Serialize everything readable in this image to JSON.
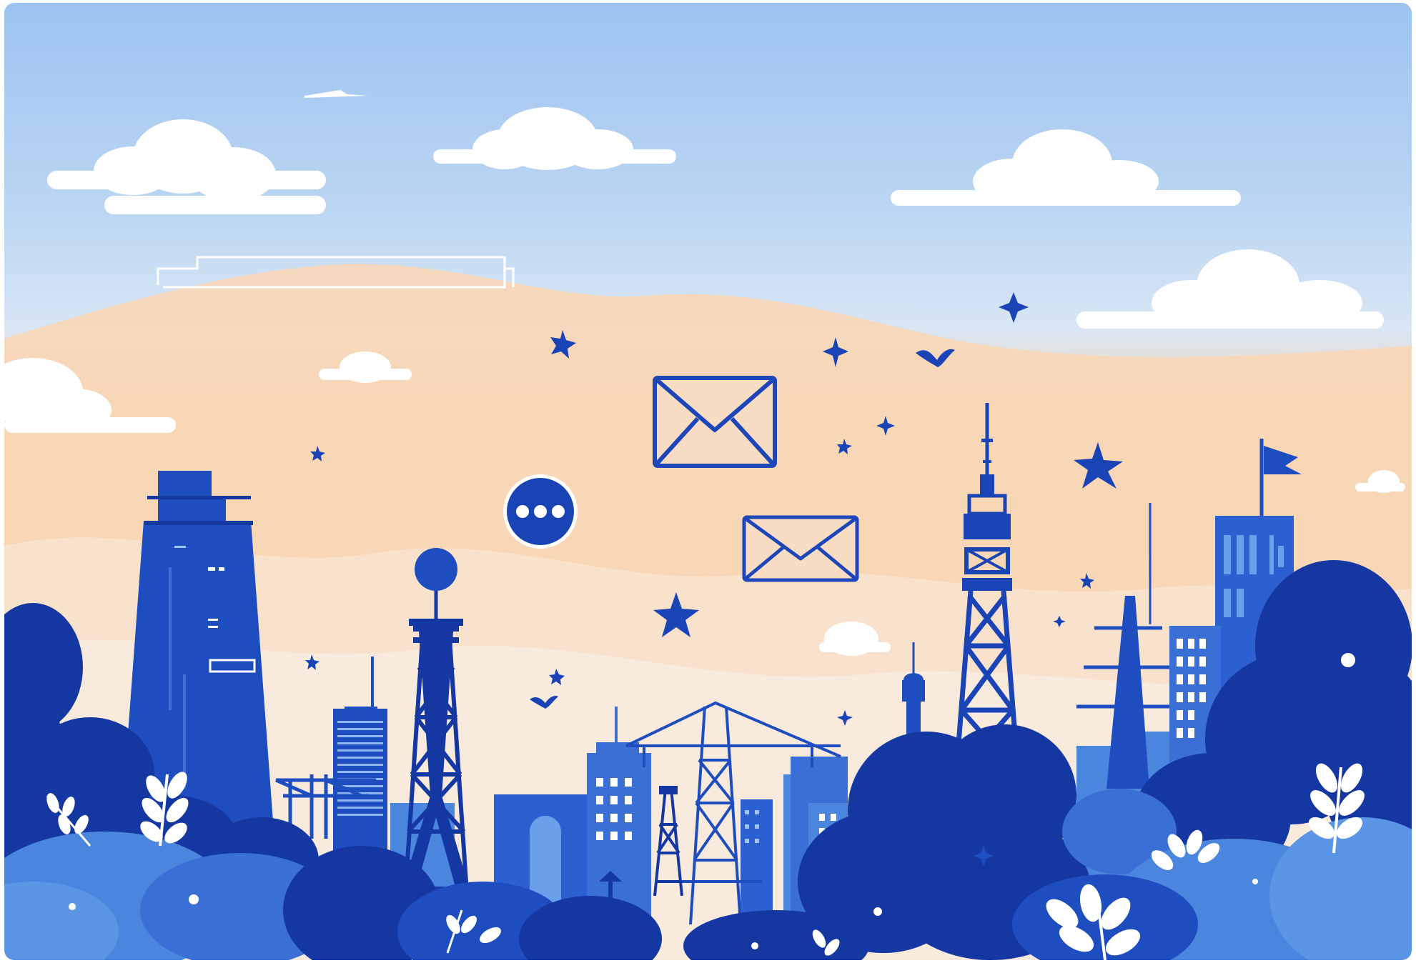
{
  "scene": {
    "description_icons": [
      "mail-icon",
      "mail-icon",
      "chat-bubble-icon",
      "sparkle-icon",
      "bird-icon",
      "flag-icon"
    ],
    "colors": {
      "sky_top": "#9ec4f0",
      "sky_mid": "#cfe1f5",
      "peach": "#f8d8bb",
      "cream": "#f6e8d8",
      "navy": "#1537a2",
      "royal": "#1f4fc2",
      "mid_blue": "#3a6fd6",
      "light_blue": "#4a86e0",
      "cloud": "#ffffff"
    }
  }
}
